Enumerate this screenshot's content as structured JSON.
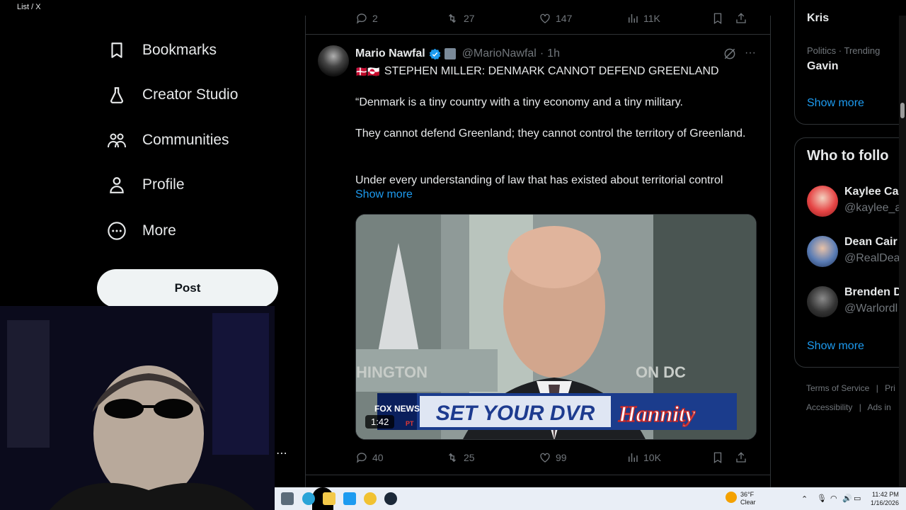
{
  "window": {
    "title": "List / X",
    "controls": [
      "—",
      "❐",
      "✕"
    ]
  },
  "sidebar": {
    "items": [
      {
        "label": "Bookmarks",
        "icon": "bookmark-icon"
      },
      {
        "label": "Creator Studio",
        "icon": "flask-icon"
      },
      {
        "label": "Communities",
        "icon": "communities-icon"
      },
      {
        "label": "Profile",
        "icon": "person-icon"
      },
      {
        "label": "More",
        "icon": "more-circle-icon"
      }
    ],
    "post_label": "Post"
  },
  "webcam": {
    "menu": "⋯"
  },
  "prev_tweet_actions": {
    "replies": "2",
    "reposts": "27",
    "likes": "147",
    "views": "11K"
  },
  "tweet": {
    "name": "Mario Nawfal",
    "handle": "@MarioNawfal",
    "dot": "·",
    "time": "1h",
    "flags": "🇩🇰🇬🇱",
    "headline": "STEPHEN MILLER: DENMARK CANNOT DEFEND GREENLAND",
    "para1": "“Denmark is a tiny country with a tiny economy and a tiny military.",
    "para2": "They cannot defend Greenland; they cannot control the territory of Greenland.",
    "para3": "Under every understanding of law that has existed about territorial control",
    "show_more": "Show more",
    "media": {
      "banner_network": "FOX NEWS",
      "banner_sub": "PT",
      "banner_text": "SET YOUR DVR",
      "banner_show": "Hannity",
      "bg_text_left": "HINGTON",
      "bg_text_right": "ON DC",
      "duration": "1:42"
    },
    "actions": {
      "replies": "40",
      "reposts": "25",
      "likes": "99",
      "views": "10K"
    }
  },
  "right": {
    "trend_top_name": "Kris",
    "trend_meta": "Politics · Trending",
    "trend_name": "Gavin",
    "trends_show_more": "Show more",
    "wtf_title": "Who to follo",
    "wtf": [
      {
        "name": "Kaylee Ca",
        "handle": "@kaylee_a"
      },
      {
        "name": "Dean Cair",
        "handle": "@RealDea"
      },
      {
        "name": "Brenden D",
        "handle": "@Warlordl"
      }
    ],
    "wtf_show_more": "Show more",
    "footer": [
      "Terms of Service",
      "|",
      "Pri",
      "Accessibility",
      "|",
      "Ads in"
    ]
  },
  "taskbar": {
    "weather_temp": "36°F",
    "weather_desc": "Clear",
    "time": "11:42 PM",
    "date": "1/16/2026"
  },
  "colors": {
    "accent": "#1d9bf0",
    "verified": "#1d9bf0",
    "muted": "#71767b"
  }
}
